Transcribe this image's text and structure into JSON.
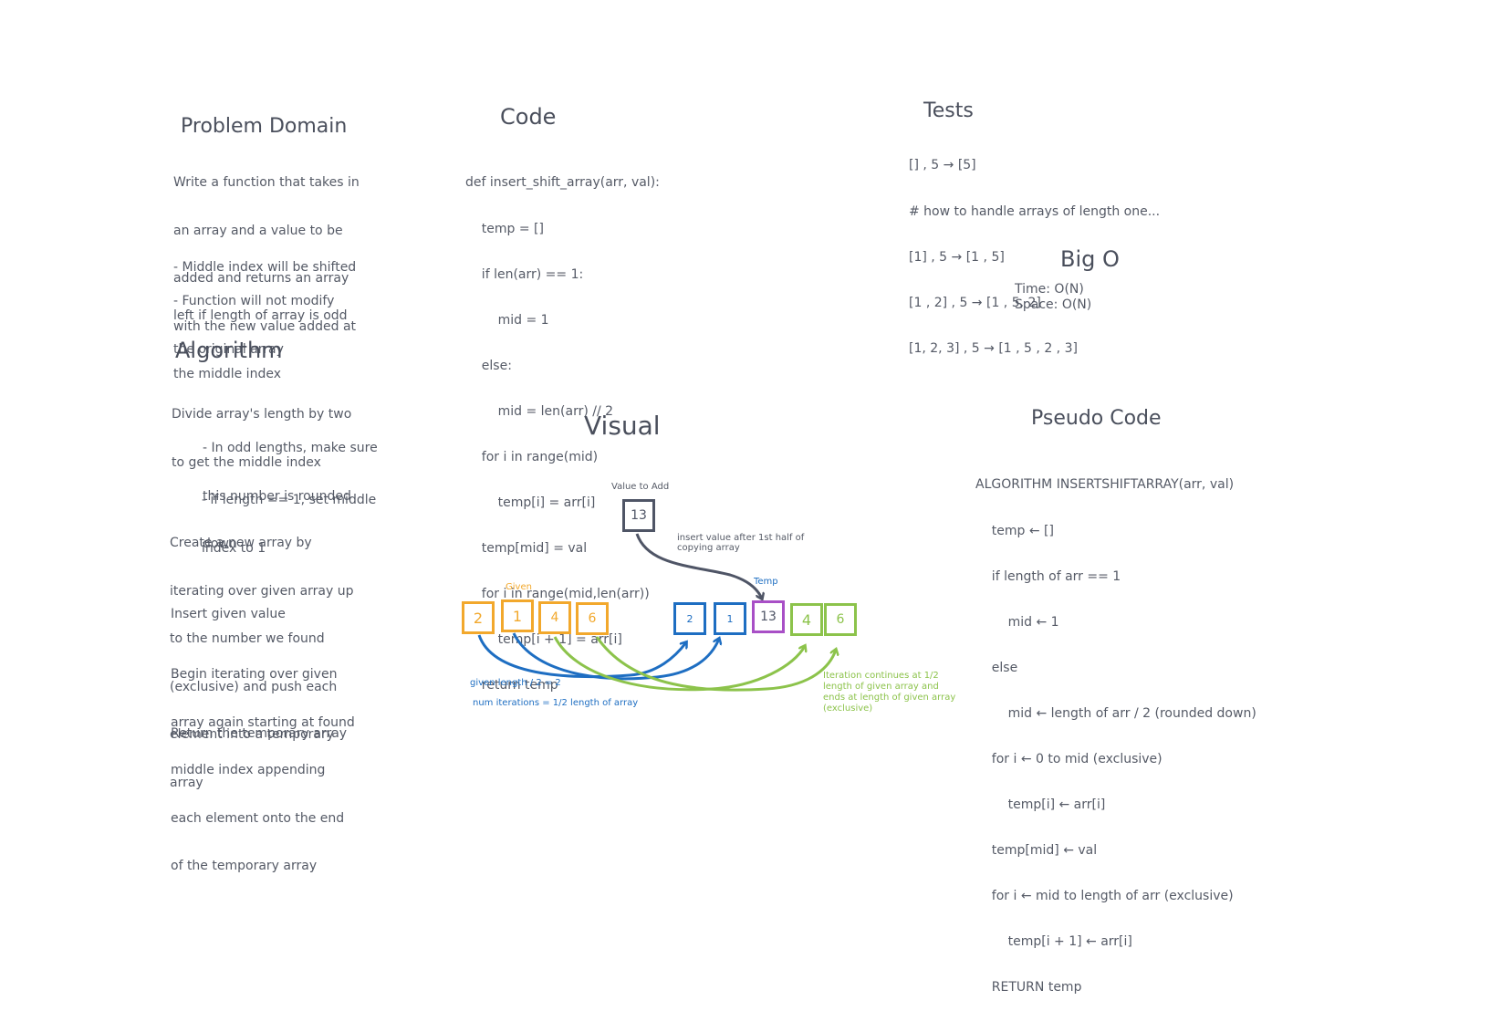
{
  "problem_domain": {
    "title": "Problem Domain",
    "lines": [
      "Write a function that takes in",
      "an array and a value to be",
      "added and returns an array",
      "with the new value added at",
      "the middle index"
    ],
    "bullet1": [
      "- Middle index will be shifted",
      "left if length of array is odd"
    ],
    "bullet2": [
      "- Function will not modify",
      "the original array"
    ]
  },
  "algorithm": {
    "title": "Algorithm",
    "p1": [
      "Divide array's length by two",
      "to get the middle index"
    ],
    "p1a": [
      "- In odd lengths, make sure",
      "this number is rounded",
      "down"
    ],
    "p1b": [
      "- if length == 1, set middle",
      "index to 1"
    ],
    "p2": [
      "Create a new array by",
      "iterating over given array up",
      "to the number we found",
      "(exclusive) and push each",
      "element into a temporary",
      "array"
    ],
    "p3": "Insert given value",
    "p4": [
      "Begin iterating over given",
      "array again starting at found",
      "middle index appending",
      "each element onto the end",
      "of the temporary array"
    ],
    "p5": "Return the temporary array"
  },
  "code": {
    "title": "Code",
    "lines": [
      "def insert_shift_array(arr, val):",
      "    temp = []",
      "    if len(arr) == 1:",
      "        mid = 1",
      "    else:",
      "        mid = len(arr) // 2",
      "    for i in range(mid)",
      "        temp[i] = arr[i]",
      "    temp[mid] = val",
      "    for i in range(mid,len(arr))",
      "        temp[i + 1] = arr[i]",
      "    return temp"
    ]
  },
  "tests": {
    "title": "Tests",
    "lines": [
      "[] , 5 → [5]",
      "# how to handle arrays of length one...",
      "[1] , 5 → [1 , 5]",
      "[1 , 2] , 5 → [1 , 5, 2]",
      "[1, 2, 3] , 5 → [1 , 5 , 2 , 3]"
    ]
  },
  "big_o": {
    "title": "Big O",
    "time": "Time: O(N)",
    "space": "Space: O(N)"
  },
  "pseudo": {
    "title": "Pseudo Code",
    "lines": [
      "ALGORITHM INSERTSHIFTARRAY(arr, val)",
      "    temp ← []",
      "    if length of arr == 1",
      "        mid ← 1",
      "    else",
      "        mid ← length of arr / 2 (rounded down)",
      "    for i ← 0 to mid (exclusive)",
      "        temp[i] ← arr[i]",
      "    temp[mid] ← val",
      "    for i ← mid to length of arr (exclusive)",
      "        temp[i + 1] ← arr[i]",
      "    RETURN temp"
    ]
  },
  "visual": {
    "title": "Visual",
    "value_label": "Value to Add",
    "value": "13",
    "insert_note": [
      "insert value after 1st half of",
      "copying array"
    ],
    "given_label": "Given",
    "given": [
      "2",
      "1",
      "4",
      "6"
    ],
    "temp_label": "Temp",
    "temp": [
      "2",
      "1",
      "13",
      "4",
      "6"
    ],
    "note_blue1": "given length / 2 = 2",
    "note_blue2": "num iterations = 1/2 length of array",
    "note_green": [
      "Iteration continues at 1/2",
      "length of given array and",
      "ends at length of given array",
      "(exclusive)"
    ],
    "colors": {
      "orange": "#f2a82c",
      "blue": "#1e6ec2",
      "purple": "#a84fc6",
      "green": "#8cc34b",
      "dark": "#4f5566"
    }
  }
}
